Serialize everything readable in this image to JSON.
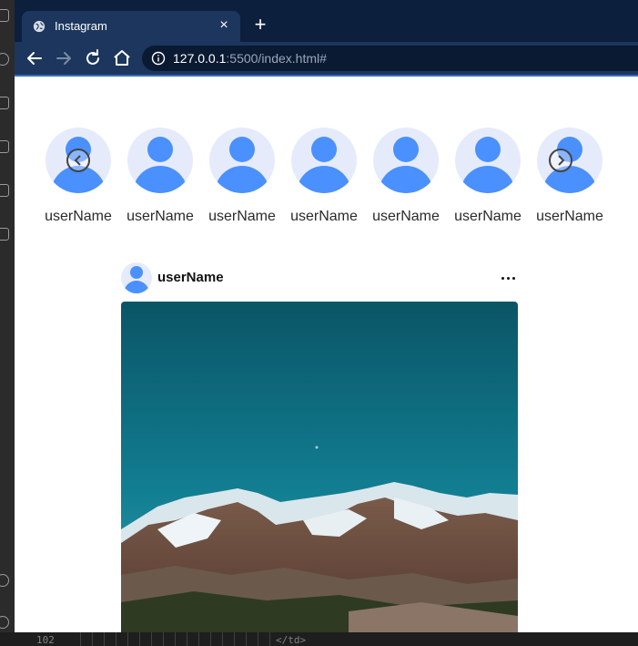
{
  "browser": {
    "tab_title": "Instagram",
    "tab_close": "×",
    "new_tab": "+",
    "url_host": "127.0.0.1",
    "url_rest": ":5500/index.html#"
  },
  "stories": [
    {
      "username": "userName"
    },
    {
      "username": "userName"
    },
    {
      "username": "userName"
    },
    {
      "username": "userName"
    },
    {
      "username": "userName"
    },
    {
      "username": "userName"
    },
    {
      "username": "userName"
    }
  ],
  "post": {
    "username": "userName",
    "image_subject": "snow-capped mountain range under teal sky"
  },
  "editor": {
    "line_number": "102",
    "code_text": "</td>"
  },
  "colors": {
    "avatar_blue": "#4a90ff",
    "avatar_bg": "#e6ebfb",
    "browser_frame": "#1c365d"
  },
  "icons": [
    "globe-icon",
    "close-icon",
    "plus-icon",
    "back-icon",
    "forward-icon",
    "reload-icon",
    "home-icon",
    "info-icon",
    "chevron-left-icon",
    "chevron-right-icon",
    "more-horizontal-icon"
  ]
}
